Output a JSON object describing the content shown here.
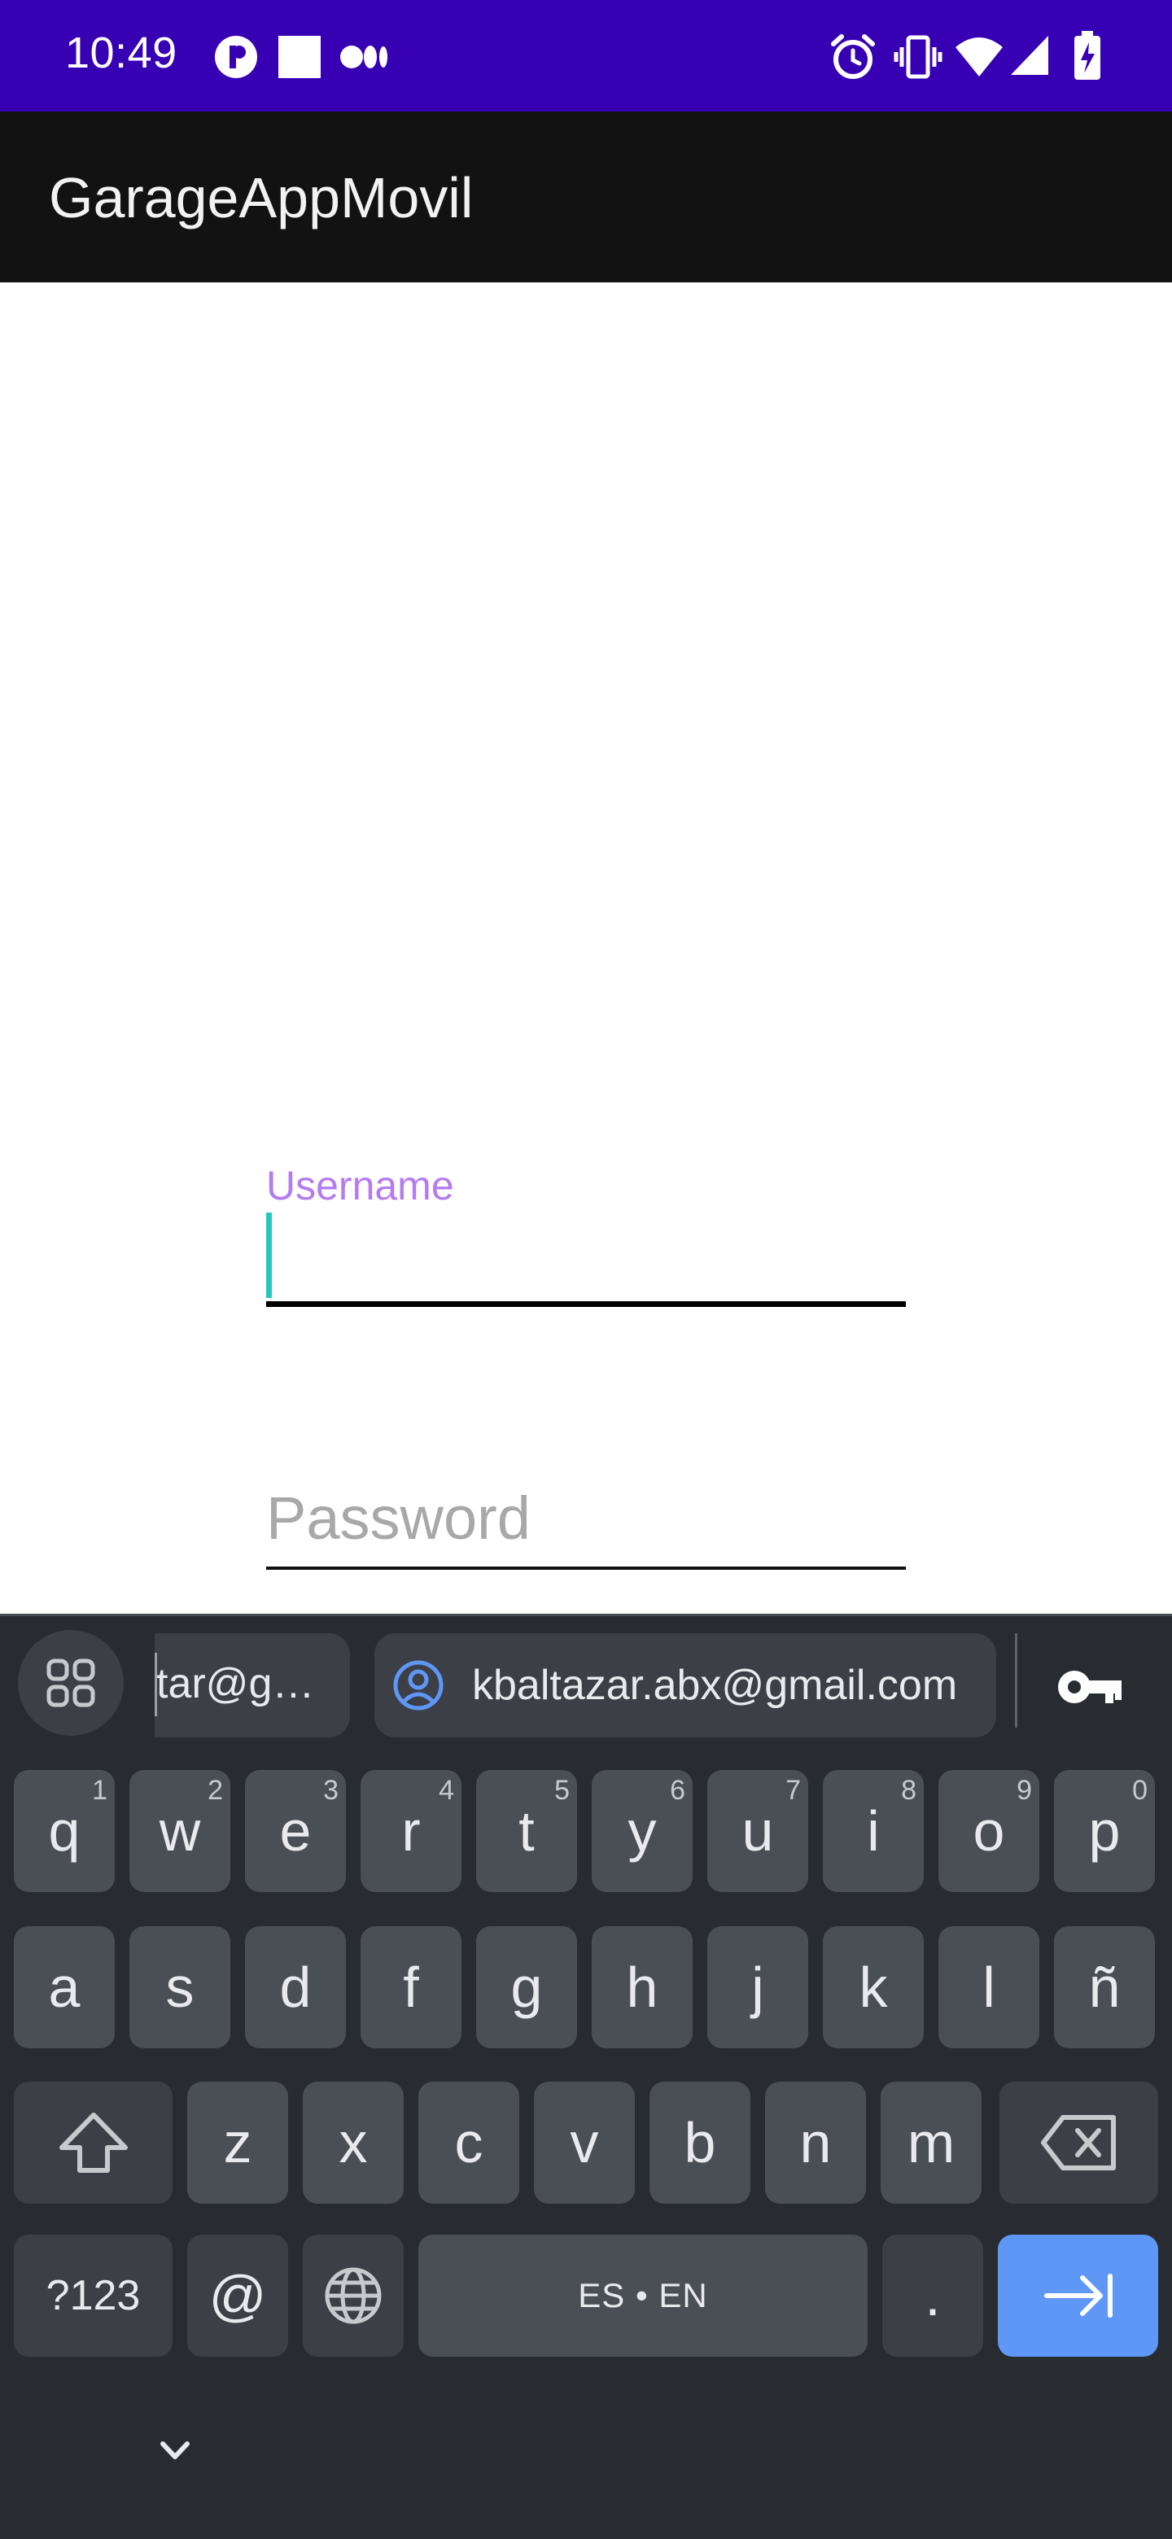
{
  "status_bar": {
    "time": "10:49"
  },
  "app": {
    "title": "GarageAppMovil"
  },
  "form": {
    "username_label": "Username",
    "username_value": "",
    "password_placeholder": "Password"
  },
  "keyboard": {
    "suggestions": {
      "partial": "tar@g…",
      "full": "kbaltazar.abx@gmail.com"
    },
    "row1": [
      {
        "letter": "q",
        "hint": "1"
      },
      {
        "letter": "w",
        "hint": "2"
      },
      {
        "letter": "e",
        "hint": "3"
      },
      {
        "letter": "r",
        "hint": "4"
      },
      {
        "letter": "t",
        "hint": "5"
      },
      {
        "letter": "y",
        "hint": "6"
      },
      {
        "letter": "u",
        "hint": "7"
      },
      {
        "letter": "i",
        "hint": "8"
      },
      {
        "letter": "o",
        "hint": "9"
      },
      {
        "letter": "p",
        "hint": "0"
      }
    ],
    "row2": [
      "a",
      "s",
      "d",
      "f",
      "g",
      "h",
      "j",
      "k",
      "l",
      "ñ"
    ],
    "row3": [
      "z",
      "x",
      "c",
      "v",
      "b",
      "n",
      "m"
    ],
    "symbols_label": "?123",
    "at_label": "@",
    "space_label": "ES • EN",
    "period_label": "."
  },
  "colors": {
    "status_bar": "#3700b3",
    "app_bar": "#121212",
    "label_accent": "#b57bf0",
    "cursor": "#26c6bf",
    "keyboard_bg": "#282c31",
    "key_bg": "#4a4f55",
    "enter_key": "#5e97f6"
  },
  "icons": {
    "status": [
      "notification-app-icon",
      "square-notification-icon",
      "media-notification-icon",
      "alarm-icon",
      "vibrate-icon",
      "wifi-icon",
      "signal-icon",
      "battery-charging-icon"
    ],
    "keyboard": [
      "apps-grid-icon",
      "account-circle-icon",
      "password-key-icon",
      "shift-icon",
      "backspace-icon",
      "globe-icon",
      "next-arrow-icon",
      "chevron-down-icon"
    ]
  }
}
